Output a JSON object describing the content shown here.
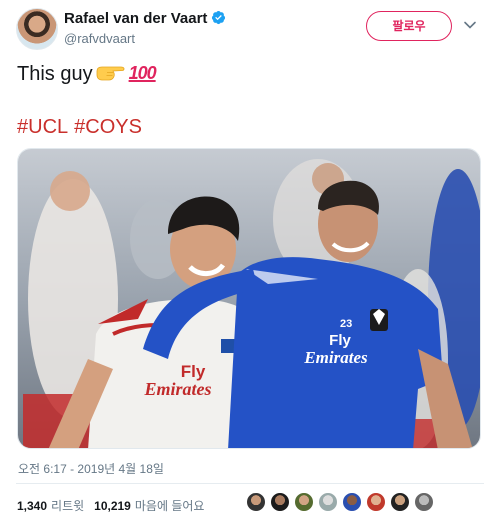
{
  "author": {
    "name": "Rafael van der Vaart",
    "handle": "@rafvdvaart",
    "verified": true
  },
  "follow_button": {
    "label": "팔로우"
  },
  "tweet": {
    "text": "This guy",
    "emojis": [
      "backhand-index-pointing-right-icon",
      "hundred-points-icon"
    ],
    "hundred_label": "100",
    "hashtags": [
      "#UCL",
      "#COYS"
    ]
  },
  "media": {
    "description": "photo",
    "shirt_text_left": [
      "Fly",
      "Emirates"
    ],
    "shirt_text_right": [
      "Fly",
      "Emirates"
    ],
    "shirt_number": "23"
  },
  "timestamp": "오전 6:17 - 2019년 4월 18일",
  "stats": {
    "retweets_count": "1,340",
    "retweets_label": "리트윗",
    "likes_count": "10,219",
    "likes_label": "마음에 들어요"
  },
  "colors": {
    "accent": "#e0245e",
    "hashtag": "#c9302c",
    "verified": "#1da1f2",
    "secondary_text": "#657786"
  }
}
